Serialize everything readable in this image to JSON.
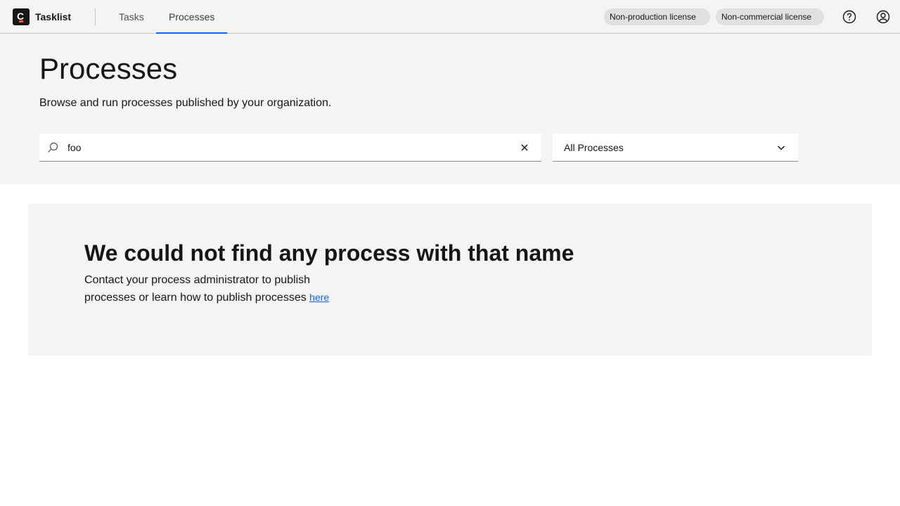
{
  "header": {
    "brand": "Tasklist",
    "logo_letter": "C",
    "nav": [
      {
        "label": "Tasks",
        "active": false
      },
      {
        "label": "Processes",
        "active": true
      }
    ],
    "tags": [
      "Non-production license",
      "Non-commercial license"
    ],
    "icons": [
      "help-icon",
      "user-icon"
    ],
    "accent_color": "#0f62fe"
  },
  "hero": {
    "title": "Processes",
    "description": "Browse and run processes published by your organization.",
    "search": {
      "value": "foo",
      "icon": "search-icon",
      "clear_icon": "close-icon"
    },
    "filter": {
      "selected": "All Processes",
      "icon": "chevron-down-icon"
    }
  },
  "empty_state": {
    "title": "We could not find any process with that name",
    "body_line1": "Contact your process administrator to publish",
    "body_line2": "processes or learn how to publish processes",
    "link_label": "here"
  }
}
